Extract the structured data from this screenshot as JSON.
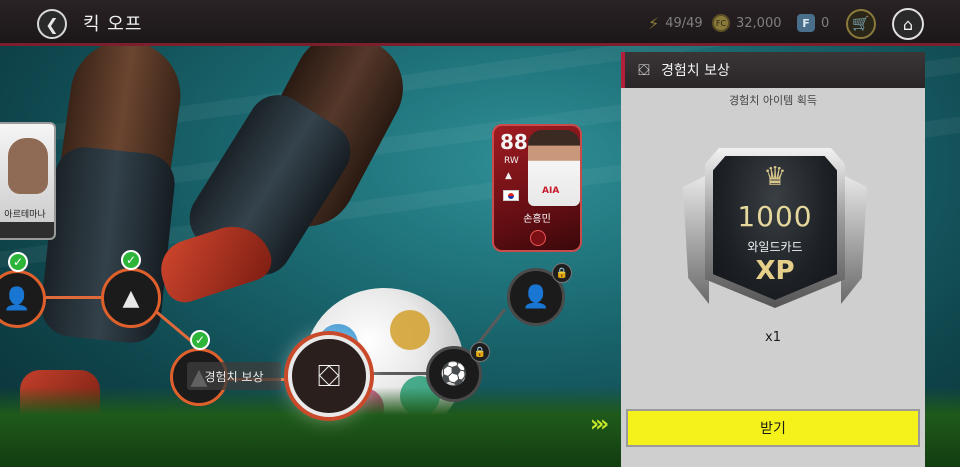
{
  "header": {
    "title": "킥 오프",
    "energy": "49/49",
    "coins": "32,000",
    "coin_icon_label": "FC",
    "fp_icon_label": "F",
    "fp_points": "0"
  },
  "progression": {
    "current_node_label": "경험치 보상",
    "completed_nodes": 3,
    "locked_nodes": 2
  },
  "cards": {
    "left_player_name": "아르테마나",
    "featured": {
      "ovr": "88",
      "position": "RW",
      "name": "손흥민",
      "sponsor": "AIA"
    }
  },
  "reward_panel": {
    "title": "경험치 보상",
    "subtitle": "경험치 아이템 획득",
    "item_amount": "1000",
    "item_type": "와일드카드",
    "item_unit": "XP",
    "quantity": "x1",
    "claim_label": "받기"
  },
  "colors": {
    "accent_red": "#b31f3b",
    "node_orange": "#e0602c",
    "claim_yellow": "#f4f21a",
    "check_green": "#2db53a"
  },
  "icons": [
    "back-arrow-icon",
    "energy-bolt-icon",
    "coin-icon",
    "fp-icon",
    "cart-icon",
    "home-icon",
    "check-icon",
    "lock-icon",
    "reward-chest-icon",
    "ball-icon",
    "player-icon",
    "cone-icon"
  ]
}
